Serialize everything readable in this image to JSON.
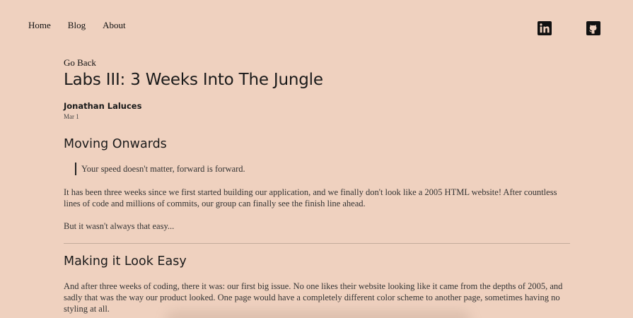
{
  "nav": {
    "items": [
      {
        "label": "Home"
      },
      {
        "label": "Blog"
      },
      {
        "label": "About"
      }
    ]
  },
  "social": {
    "linkedin_icon": "linkedin-icon",
    "github_icon": "github-icon"
  },
  "post": {
    "go_back": "Go Back",
    "title": "Labs III: 3 Weeks Into The Jungle",
    "author": "Jonathan Laluces",
    "date": "Mar 1",
    "sections": [
      {
        "heading": "Moving Onwards",
        "quote": "Your speed doesn't matter, forward is forward.",
        "paragraphs": [
          "It has been three weeks since we first started building our application, and we finally don't look like a 2005 HTML website! After countless lines of code and millions of commits, our group can finally see the finish line ahead.",
          "But it wasn't always that easy..."
        ]
      },
      {
        "heading": "Making it Look Easy",
        "paragraphs": [
          "And after three weeks of coding, there it was: our first big issue. No one likes their website looking like it came from the depths of 2005, and sadly that was the way our product looked. One page would have a completely different color scheme to another page, sometimes having no styling at all."
        ]
      }
    ]
  },
  "colors": {
    "background": "#efd1bf",
    "text": "#222222",
    "divider": "#c4ab9b"
  }
}
